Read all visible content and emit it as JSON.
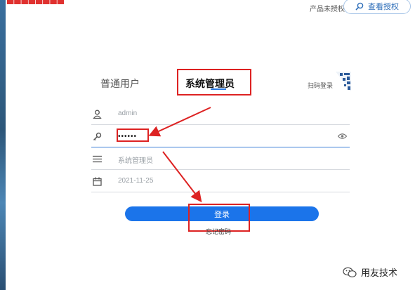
{
  "header": {
    "unauthorized_text": "产品未授权",
    "view_authorization_label": "查看授权"
  },
  "tabs": [
    {
      "label": "普通用户",
      "active": false
    },
    {
      "label": "系统管理员",
      "active": true
    }
  ],
  "qr_login": {
    "label": "扫码登录"
  },
  "form": {
    "username": "admin",
    "password": "••••••",
    "role": "系统管理员",
    "date": "2021-11-25"
  },
  "login_button_label": "登录",
  "forgot_password_label": "忘记密码",
  "watermark": {
    "text": "用友技术"
  },
  "colors": {
    "accent": "#1b74ea",
    "annotation": "#dd2222"
  }
}
